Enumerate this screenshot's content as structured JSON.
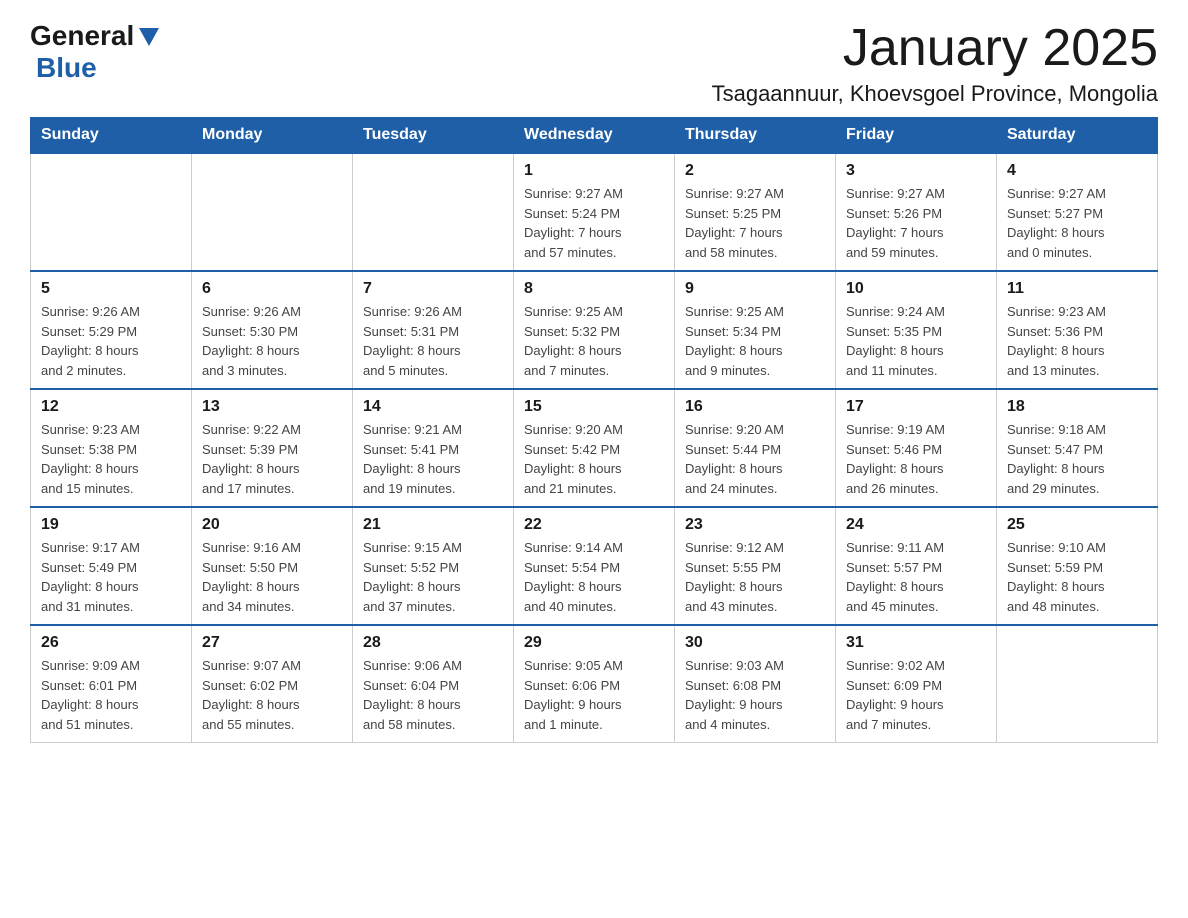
{
  "header": {
    "logo_general": "General",
    "logo_blue": "Blue",
    "month_title": "January 2025",
    "location": "Tsagaannuur, Khoevsgoel Province, Mongolia"
  },
  "days_of_week": [
    "Sunday",
    "Monday",
    "Tuesday",
    "Wednesday",
    "Thursday",
    "Friday",
    "Saturday"
  ],
  "weeks": [
    [
      {
        "day": "",
        "info": ""
      },
      {
        "day": "",
        "info": ""
      },
      {
        "day": "",
        "info": ""
      },
      {
        "day": "1",
        "info": "Sunrise: 9:27 AM\nSunset: 5:24 PM\nDaylight: 7 hours\nand 57 minutes."
      },
      {
        "day": "2",
        "info": "Sunrise: 9:27 AM\nSunset: 5:25 PM\nDaylight: 7 hours\nand 58 minutes."
      },
      {
        "day": "3",
        "info": "Sunrise: 9:27 AM\nSunset: 5:26 PM\nDaylight: 7 hours\nand 59 minutes."
      },
      {
        "day": "4",
        "info": "Sunrise: 9:27 AM\nSunset: 5:27 PM\nDaylight: 8 hours\nand 0 minutes."
      }
    ],
    [
      {
        "day": "5",
        "info": "Sunrise: 9:26 AM\nSunset: 5:29 PM\nDaylight: 8 hours\nand 2 minutes."
      },
      {
        "day": "6",
        "info": "Sunrise: 9:26 AM\nSunset: 5:30 PM\nDaylight: 8 hours\nand 3 minutes."
      },
      {
        "day": "7",
        "info": "Sunrise: 9:26 AM\nSunset: 5:31 PM\nDaylight: 8 hours\nand 5 minutes."
      },
      {
        "day": "8",
        "info": "Sunrise: 9:25 AM\nSunset: 5:32 PM\nDaylight: 8 hours\nand 7 minutes."
      },
      {
        "day": "9",
        "info": "Sunrise: 9:25 AM\nSunset: 5:34 PM\nDaylight: 8 hours\nand 9 minutes."
      },
      {
        "day": "10",
        "info": "Sunrise: 9:24 AM\nSunset: 5:35 PM\nDaylight: 8 hours\nand 11 minutes."
      },
      {
        "day": "11",
        "info": "Sunrise: 9:23 AM\nSunset: 5:36 PM\nDaylight: 8 hours\nand 13 minutes."
      }
    ],
    [
      {
        "day": "12",
        "info": "Sunrise: 9:23 AM\nSunset: 5:38 PM\nDaylight: 8 hours\nand 15 minutes."
      },
      {
        "day": "13",
        "info": "Sunrise: 9:22 AM\nSunset: 5:39 PM\nDaylight: 8 hours\nand 17 minutes."
      },
      {
        "day": "14",
        "info": "Sunrise: 9:21 AM\nSunset: 5:41 PM\nDaylight: 8 hours\nand 19 minutes."
      },
      {
        "day": "15",
        "info": "Sunrise: 9:20 AM\nSunset: 5:42 PM\nDaylight: 8 hours\nand 21 minutes."
      },
      {
        "day": "16",
        "info": "Sunrise: 9:20 AM\nSunset: 5:44 PM\nDaylight: 8 hours\nand 24 minutes."
      },
      {
        "day": "17",
        "info": "Sunrise: 9:19 AM\nSunset: 5:46 PM\nDaylight: 8 hours\nand 26 minutes."
      },
      {
        "day": "18",
        "info": "Sunrise: 9:18 AM\nSunset: 5:47 PM\nDaylight: 8 hours\nand 29 minutes."
      }
    ],
    [
      {
        "day": "19",
        "info": "Sunrise: 9:17 AM\nSunset: 5:49 PM\nDaylight: 8 hours\nand 31 minutes."
      },
      {
        "day": "20",
        "info": "Sunrise: 9:16 AM\nSunset: 5:50 PM\nDaylight: 8 hours\nand 34 minutes."
      },
      {
        "day": "21",
        "info": "Sunrise: 9:15 AM\nSunset: 5:52 PM\nDaylight: 8 hours\nand 37 minutes."
      },
      {
        "day": "22",
        "info": "Sunrise: 9:14 AM\nSunset: 5:54 PM\nDaylight: 8 hours\nand 40 minutes."
      },
      {
        "day": "23",
        "info": "Sunrise: 9:12 AM\nSunset: 5:55 PM\nDaylight: 8 hours\nand 43 minutes."
      },
      {
        "day": "24",
        "info": "Sunrise: 9:11 AM\nSunset: 5:57 PM\nDaylight: 8 hours\nand 45 minutes."
      },
      {
        "day": "25",
        "info": "Sunrise: 9:10 AM\nSunset: 5:59 PM\nDaylight: 8 hours\nand 48 minutes."
      }
    ],
    [
      {
        "day": "26",
        "info": "Sunrise: 9:09 AM\nSunset: 6:01 PM\nDaylight: 8 hours\nand 51 minutes."
      },
      {
        "day": "27",
        "info": "Sunrise: 9:07 AM\nSunset: 6:02 PM\nDaylight: 8 hours\nand 55 minutes."
      },
      {
        "day": "28",
        "info": "Sunrise: 9:06 AM\nSunset: 6:04 PM\nDaylight: 8 hours\nand 58 minutes."
      },
      {
        "day": "29",
        "info": "Sunrise: 9:05 AM\nSunset: 6:06 PM\nDaylight: 9 hours\nand 1 minute."
      },
      {
        "day": "30",
        "info": "Sunrise: 9:03 AM\nSunset: 6:08 PM\nDaylight: 9 hours\nand 4 minutes."
      },
      {
        "day": "31",
        "info": "Sunrise: 9:02 AM\nSunset: 6:09 PM\nDaylight: 9 hours\nand 7 minutes."
      },
      {
        "day": "",
        "info": ""
      }
    ]
  ]
}
